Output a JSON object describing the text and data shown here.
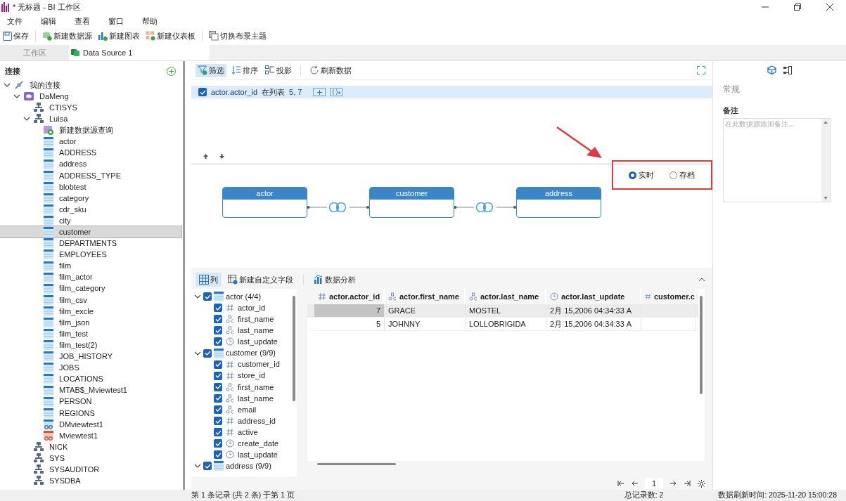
{
  "window": {
    "title": "* 无标题 - BI 工作区"
  },
  "menu": [
    "文件",
    "编辑",
    "查看",
    "窗口",
    "帮助"
  ],
  "toolbar": [
    {
      "label": "保存",
      "kind": "save"
    },
    {
      "label": "新建数据源",
      "kind": "datasource"
    },
    {
      "label": "新建图表",
      "kind": "chart"
    },
    {
      "label": "新建仪表板",
      "kind": "dashboard"
    },
    {
      "label": "切换布景主题",
      "kind": "theme"
    }
  ],
  "tabs": [
    {
      "label": "工作区",
      "selected": false
    },
    {
      "label": "Data Source 1",
      "selected": true
    }
  ],
  "sidebar": {
    "title": "连接",
    "tree": [
      {
        "label": "我的连接",
        "kind": "group",
        "expanded": true,
        "selected": false,
        "children": [
          {
            "label": "DaMeng",
            "kind": "connection",
            "expanded": true,
            "selected": false,
            "children": [
              {
                "label": "CTISYS",
                "kind": "schema",
                "selected": false
              },
              {
                "label": "Luisa",
                "kind": "schema",
                "expanded": true,
                "selected": false,
                "children": [
                  {
                    "label": "新建数据源查询",
                    "kind": "query",
                    "selected": false
                  },
                  {
                    "label": "actor",
                    "kind": "table",
                    "selected": false
                  },
                  {
                    "label": "ADDRESS",
                    "kind": "table",
                    "selected": false
                  },
                  {
                    "label": "address",
                    "kind": "table",
                    "selected": false
                  },
                  {
                    "label": "ADDRESS_TYPE",
                    "kind": "table",
                    "selected": false
                  },
                  {
                    "label": "blobtest",
                    "kind": "table",
                    "selected": false
                  },
                  {
                    "label": "category",
                    "kind": "table",
                    "selected": false
                  },
                  {
                    "label": "cdr_sku",
                    "kind": "table",
                    "selected": false
                  },
                  {
                    "label": "city",
                    "kind": "table",
                    "selected": false
                  },
                  {
                    "label": "customer",
                    "kind": "table",
                    "selected": true
                  },
                  {
                    "label": "DEPARTMENTS",
                    "kind": "table",
                    "selected": false
                  },
                  {
                    "label": "EMPLOYEES",
                    "kind": "table",
                    "selected": false
                  },
                  {
                    "label": "film",
                    "kind": "table",
                    "selected": false
                  },
                  {
                    "label": "film_actor",
                    "kind": "table",
                    "selected": false
                  },
                  {
                    "label": "film_category",
                    "kind": "table",
                    "selected": false
                  },
                  {
                    "label": "film_csv",
                    "kind": "table",
                    "selected": false
                  },
                  {
                    "label": "film_excle",
                    "kind": "table",
                    "selected": false
                  },
                  {
                    "label": "film_json",
                    "kind": "table",
                    "selected": false
                  },
                  {
                    "label": "film_test",
                    "kind": "table",
                    "selected": false
                  },
                  {
                    "label": "film_test(2)",
                    "kind": "table",
                    "selected": false
                  },
                  {
                    "label": "JOB_HISTORY",
                    "kind": "table",
                    "selected": false
                  },
                  {
                    "label": "JOBS",
                    "kind": "table",
                    "selected": false
                  },
                  {
                    "label": "LOCATIONS",
                    "kind": "table",
                    "selected": false
                  },
                  {
                    "label": "MTAB$_Mviewtest1",
                    "kind": "table",
                    "selected": false
                  },
                  {
                    "label": "PERSON",
                    "kind": "table",
                    "selected": false
                  },
                  {
                    "label": "REGIONS",
                    "kind": "table",
                    "selected": false
                  },
                  {
                    "label": "DMviewtest1",
                    "kind": "view",
                    "selected": false
                  },
                  {
                    "label": "Mviewtest1",
                    "kind": "mview",
                    "selected": false
                  }
                ]
              },
              {
                "label": "NICK",
                "kind": "schema",
                "selected": false
              },
              {
                "label": "SYS",
                "kind": "schema",
                "selected": false
              },
              {
                "label": "SYSAUDITOR",
                "kind": "schema",
                "selected": false
              },
              {
                "label": "SYSDBA",
                "kind": "schema",
                "selected": false
              }
            ]
          }
        ]
      }
    ]
  },
  "filter_toolbar": [
    {
      "label": "筛选",
      "kind": "filter",
      "selected": true
    },
    {
      "label": "排序",
      "kind": "sort",
      "selected": false
    },
    {
      "label": "投影",
      "kind": "projection",
      "selected": false
    },
    {
      "label": "刷新数据",
      "kind": "refresh",
      "selected": false
    }
  ],
  "filters": [
    {
      "field": "actor.actor_id",
      "operator": "在列表",
      "value": "5, 7",
      "checked": true
    }
  ],
  "mode_options": [
    {
      "label": "实时",
      "selected": true
    },
    {
      "label": "存档",
      "selected": false
    }
  ],
  "diagram": {
    "nodes": [
      {
        "label": "actor"
      },
      {
        "label": "customer"
      },
      {
        "label": "address"
      }
    ]
  },
  "bottom_toolbar": [
    {
      "label": "列",
      "kind": "columns",
      "selected": true
    },
    {
      "label": "新建自定义字段",
      "kind": "custom",
      "selected": false
    },
    {
      "label": "数据分析",
      "kind": "analysis",
      "selected": false
    }
  ],
  "fields": [
    {
      "label": "actor (4/4)",
      "checked": true,
      "expanded": true,
      "children": [
        {
          "label": "actor_id",
          "kind": "number",
          "checked": true
        },
        {
          "label": "first_name",
          "kind": "text",
          "checked": true
        },
        {
          "label": "last_name",
          "kind": "text",
          "checked": true
        },
        {
          "label": "last_update",
          "kind": "date",
          "checked": true
        }
      ]
    },
    {
      "label": "customer (9/9)",
      "checked": true,
      "expanded": true,
      "children": [
        {
          "label": "customer_id",
          "kind": "number",
          "checked": true
        },
        {
          "label": "store_id",
          "kind": "number",
          "checked": true
        },
        {
          "label": "first_name",
          "kind": "text",
          "checked": true
        },
        {
          "label": "last_name",
          "kind": "text",
          "checked": true
        },
        {
          "label": "email",
          "kind": "text",
          "checked": true
        },
        {
          "label": "address_id",
          "kind": "number",
          "checked": true
        },
        {
          "label": "active",
          "kind": "number",
          "checked": true
        },
        {
          "label": "create_date",
          "kind": "date",
          "checked": true
        },
        {
          "label": "last_update",
          "kind": "date",
          "checked": true
        }
      ]
    },
    {
      "label": "address (9/9)",
      "checked": true,
      "expanded": true
    }
  ],
  "table": {
    "columns": [
      {
        "label": "actor.actor_id",
        "kind": "number"
      },
      {
        "label": "actor.first_name",
        "kind": "text"
      },
      {
        "label": "actor.last_name",
        "kind": "text"
      },
      {
        "label": "actor.last_update",
        "kind": "date"
      },
      {
        "label": "customer.c",
        "kind": "number"
      }
    ],
    "rows": [
      {
        "selected": true,
        "cells": [
          "7",
          "GRACE",
          "MOSTEL",
          "2月 15,2006 04:34:33 A",
          ""
        ]
      },
      {
        "selected": false,
        "cells": [
          "5",
          "JOHNNY",
          "LOLLOBRIGIDA",
          "2月 15,2006 04:34:33 A",
          ""
        ]
      }
    ]
  },
  "pagination": {
    "page": "1"
  },
  "properties": {
    "section": "常规",
    "note_label": "备注",
    "note_placeholder": "在此数据源添加备注..."
  },
  "status_bar": {
    "record": "第 1 条记录 (共 2 条) 于第 1 页",
    "total": "总记录数: 2",
    "refresh_time": "数据刷新时间: 2025-11-20 15:00:28"
  }
}
